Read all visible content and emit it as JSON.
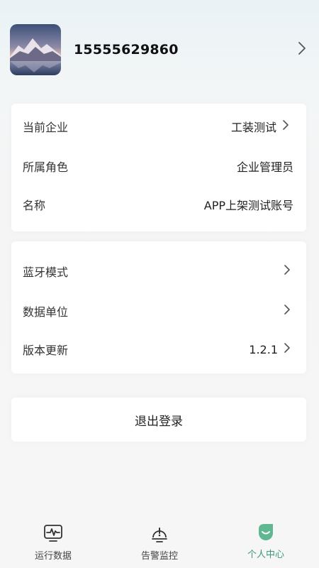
{
  "profile": {
    "phone": "15555629860"
  },
  "company_card": {
    "rows": [
      {
        "label": "当前企业",
        "value": "工装测试"
      },
      {
        "label": "所属角色",
        "value": "企业管理员"
      },
      {
        "label": "名称",
        "value": "APP上架测试账号"
      }
    ]
  },
  "settings_card": {
    "rows": [
      {
        "label": "蓝牙模式",
        "value": ""
      },
      {
        "label": "数据单位",
        "value": ""
      },
      {
        "label": "版本更新",
        "value": "1.2.1"
      }
    ]
  },
  "logout_label": "退出登录",
  "tabbar": {
    "tabs": [
      {
        "label": "运行数据",
        "icon": "waveform-monitor-icon"
      },
      {
        "label": "告警监控",
        "icon": "alarm-lamp-icon"
      },
      {
        "label": "个人中心",
        "icon": "smiley-person-icon"
      }
    ],
    "active_index": 2,
    "active_color": "#3a9a7a"
  }
}
